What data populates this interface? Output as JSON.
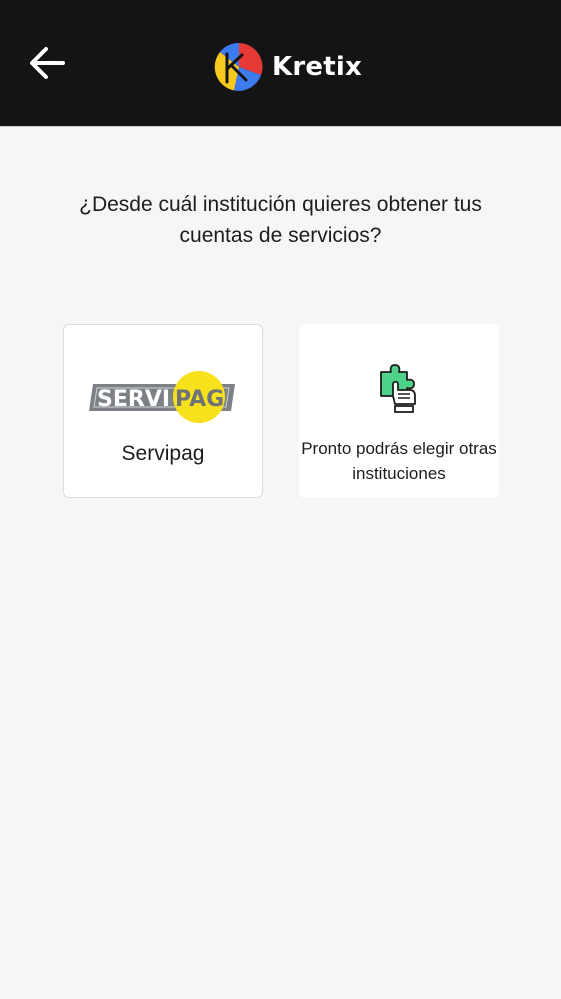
{
  "header": {
    "back_icon": "arrow-left-icon",
    "brand_name": "Kretix",
    "background_color": "#141414",
    "logo_colors": [
      "#e53935",
      "#3d7bf0",
      "#f7c81e"
    ]
  },
  "main": {
    "question": "¿Desde cuál institución quieres obtener tus cuentas de servicios?",
    "institutions": [
      {
        "name": "Servipag",
        "logo_text_left": "SERVI",
        "logo_text_right": "PAG",
        "logo_colors": [
          "#7d8185",
          "#f7e11b"
        ]
      }
    ],
    "coming_soon": {
      "icon": "puzzle-hand-icon",
      "text": "Pronto podrás elegir otras instituciones",
      "icon_color": "#4fd38b"
    }
  }
}
